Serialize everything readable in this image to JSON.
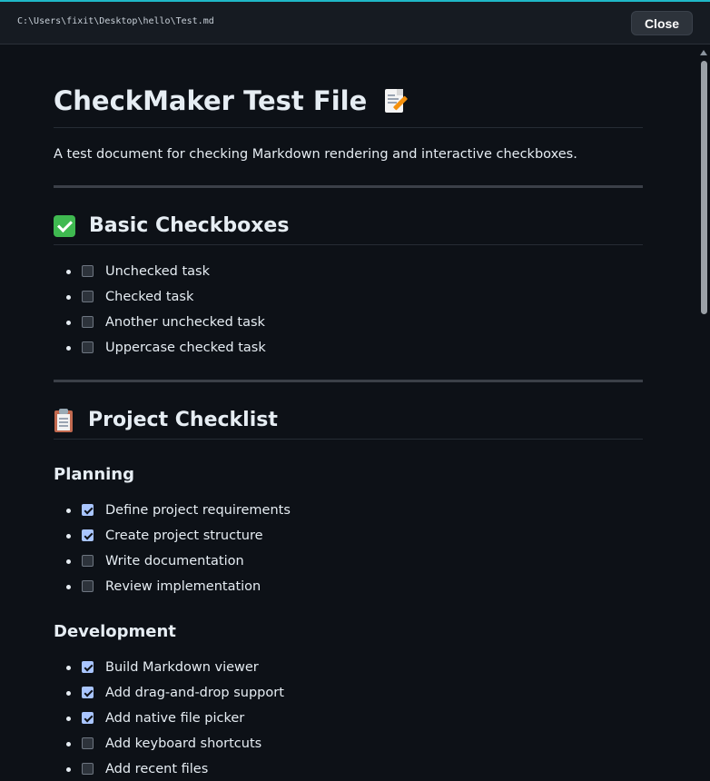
{
  "titlebar": {
    "path": "C:\\Users\\fixit\\Desktop\\hello\\Test.md",
    "close_label": "Close"
  },
  "document": {
    "title": "CheckMaker Test File",
    "title_icon": "memo-icon",
    "description": "A test document for checking Markdown rendering and interactive checkboxes.",
    "sections": {
      "basic": {
        "heading": "Basic Checkboxes",
        "icon": "check-mark-button-icon",
        "items": [
          {
            "label": "Unchecked task",
            "checked": false
          },
          {
            "label": "Checked task",
            "checked": false
          },
          {
            "label": "Another unchecked task",
            "checked": false
          },
          {
            "label": "Uppercase checked task",
            "checked": false
          }
        ]
      },
      "project": {
        "heading": "Project Checklist",
        "icon": "clipboard-icon",
        "planning": {
          "heading": "Planning",
          "items": [
            {
              "label": "Define project requirements",
              "checked": true
            },
            {
              "label": "Create project structure",
              "checked": true
            },
            {
              "label": "Write documentation",
              "checked": false
            },
            {
              "label": "Review implementation",
              "checked": false
            }
          ]
        },
        "development": {
          "heading": "Development",
          "items": [
            {
              "label": "Build Markdown viewer",
              "checked": true
            },
            {
              "label": "Add drag-and-drop support",
              "checked": true
            },
            {
              "label": "Add native file picker",
              "checked": true
            },
            {
              "label": "Add keyboard shortcuts",
              "checked": false
            },
            {
              "label": "Add recent files",
              "checked": false
            }
          ]
        }
      }
    }
  },
  "colors": {
    "accent": "#1fb8c7",
    "checkbox_checked": "#a9c5ff",
    "background": "#0d1117"
  }
}
